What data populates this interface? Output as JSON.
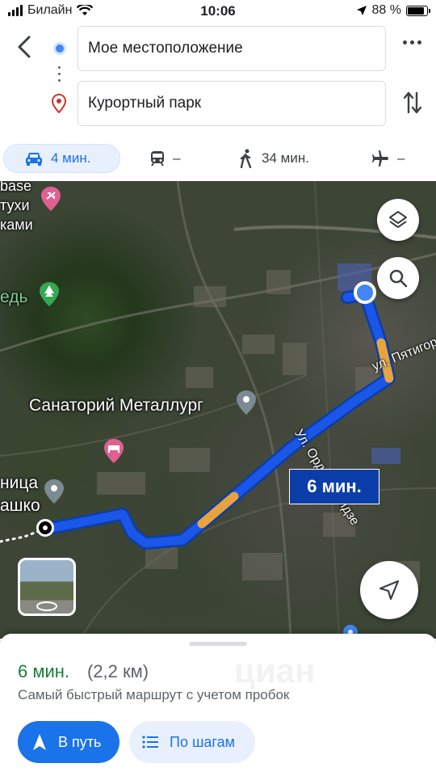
{
  "status_bar": {
    "carrier": "Билайн",
    "time": "10:06",
    "battery": "88 %",
    "battery_level": 0.88
  },
  "route_inputs": {
    "origin": "Мое местоположение",
    "destination": "Курортный парк"
  },
  "modes": [
    {
      "icon": "car-icon",
      "label": "4 мин.",
      "active": true
    },
    {
      "icon": "transit-icon",
      "label": "–",
      "active": false
    },
    {
      "icon": "walk-icon",
      "label": "34 мин.",
      "active": false
    },
    {
      "icon": "flight-icon",
      "label": "–",
      "active": false
    }
  ],
  "map": {
    "labels": {
      "sanatorium": "Санаторий Металлург",
      "park_fragment": "едь",
      "top_fragment_1": "тухи",
      "top_fragment_2": "ками",
      "top_fragment_3": "base",
      "hospital_1": "ница",
      "hospital_2": "ашко"
    },
    "streets": {
      "pyatigorskaya": "ул. Пятигор",
      "ordzhonikidze": "Ул. Орджоникидзе"
    },
    "eta_badge": "6 мин.",
    "route_colors": {
      "fast": "#1a56e8",
      "slow": "#e8a33d"
    }
  },
  "sheet": {
    "duration": "6 мин.",
    "distance": "(2,2 км)",
    "description": "Самый быстрый маршрут с учетом пробок",
    "start_label": "В путь",
    "steps_label": "По шагам",
    "watermark": "циан"
  }
}
